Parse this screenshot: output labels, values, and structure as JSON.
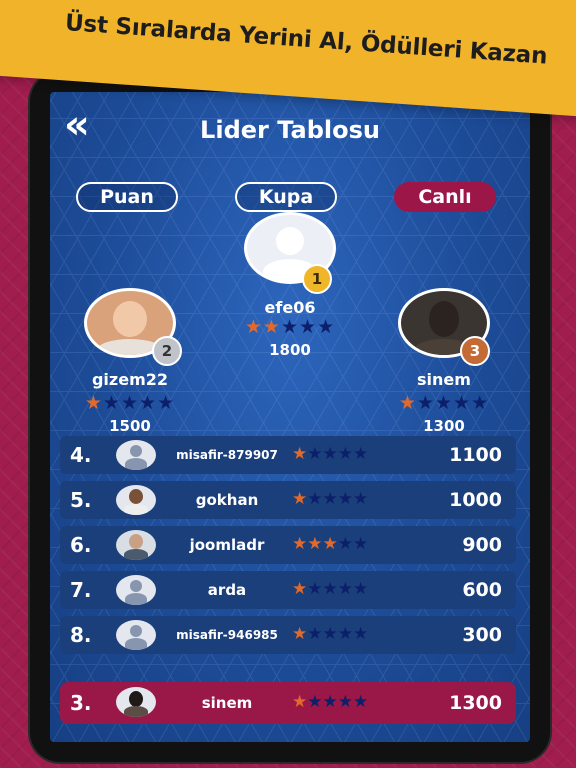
{
  "banner": {
    "text": "Üst Sıralarda Yerini Al, Ödülleri Kazan"
  },
  "header": {
    "title": "Lider Tablosu",
    "back_icon": "double-chevron-left-icon"
  },
  "tabs": [
    {
      "label": "Puan",
      "active": false
    },
    {
      "label": "Kupa",
      "active": false
    },
    {
      "label": "Canlı",
      "active": true
    }
  ],
  "podium": {
    "first": {
      "name": "efe06",
      "rank": "1",
      "score": "1800",
      "stars": 2
    },
    "second": {
      "name": "gizem22",
      "rank": "2",
      "score": "1500",
      "stars": 1
    },
    "third": {
      "name": "sinem",
      "rank": "3",
      "score": "1300",
      "stars": 1
    }
  },
  "rows": [
    {
      "rank": "4.",
      "name": "misafir-879907",
      "stars": 1,
      "score": "1100"
    },
    {
      "rank": "5.",
      "name": "gokhan",
      "stars": 1,
      "score": "1000"
    },
    {
      "rank": "6.",
      "name": "joomladr",
      "stars": 3,
      "score": "900"
    },
    {
      "rank": "7.",
      "name": "arda",
      "stars": 1,
      "score": "600"
    },
    {
      "rank": "8.",
      "name": "misafir-946985",
      "stars": 1,
      "score": "300"
    }
  ],
  "me": {
    "rank": "3.",
    "name": "sinem",
    "stars": 1,
    "score": "1300"
  },
  "colors": {
    "background": "#a01d4e",
    "banner": "#f1b32a",
    "screen": "#1f4f9e",
    "active_tab": "#9c1748",
    "star_on": "#e2692a",
    "star_off": "#0c1f6a"
  },
  "max_stars": 5
}
